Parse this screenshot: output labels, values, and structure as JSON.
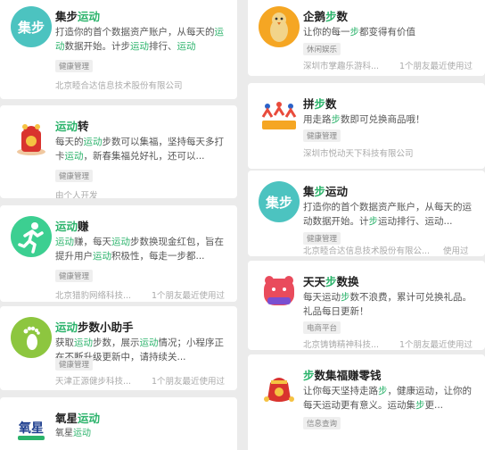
{
  "left": [
    {
      "icon": "jibu-logo-icon",
      "icon_text": "集步",
      "title": [
        {
          "t": "集步"
        },
        {
          "t": "运动",
          "g": true
        }
      ],
      "desc": [
        {
          "t": "打造你的首个数据资产账户，从每天的"
        },
        {
          "t": "运动",
          "g": true
        },
        {
          "t": "数据开始。计步"
        },
        {
          "t": "运动",
          "g": true
        },
        {
          "t": "排行、"
        },
        {
          "t": "运动",
          "g": true
        }
      ],
      "tag": "健康管理",
      "company": "北京睦合达信息技术股份有限公司",
      "friends": ""
    },
    {
      "icon": "red-envelope-fortune-icon",
      "title": [
        {
          "t": "运动",
          "g": true
        },
        {
          "t": "转"
        }
      ],
      "desc": [
        {
          "t": "每天的"
        },
        {
          "t": "运动",
          "g": true
        },
        {
          "t": "步数可以集福，坚持每天多打卡"
        },
        {
          "t": "运动",
          "g": true
        },
        {
          "t": "，新春集福兑好礼，还可以..."
        }
      ],
      "tag": "健康管理",
      "company": "由个人开发",
      "friends": ""
    },
    {
      "icon": "running-man-icon",
      "title": [
        {
          "t": "运动",
          "g": true
        },
        {
          "t": "赚"
        }
      ],
      "desc": [
        {
          "t": "运动",
          "g": true
        },
        {
          "t": "赚，每天"
        },
        {
          "t": "运动",
          "g": true
        },
        {
          "t": "步数换现金红包，旨在提升用户"
        },
        {
          "t": "运动",
          "g": true
        },
        {
          "t": "积极性，每走一步都..."
        }
      ],
      "tag": "健康管理",
      "company": "北京猎豹网络科技...",
      "friends": "1个朋友最近使用过"
    },
    {
      "icon": "footprint-icon",
      "title": [
        {
          "t": "运动",
          "g": true
        },
        {
          "t": "步数小助手"
        }
      ],
      "desc": [
        {
          "t": "获取"
        },
        {
          "t": "运动",
          "g": true
        },
        {
          "t": "步数，展示"
        },
        {
          "t": "运动",
          "g": true
        },
        {
          "t": "情况；小程序正在不断升级更新中，请持续关..."
        }
      ],
      "tag": "健康管理",
      "company": "天津正源健步科技...",
      "friends": "1个朋友最近使用过"
    },
    {
      "icon": "oxygen-star-logo-icon",
      "icon_text": "氧星",
      "title": [
        {
          "t": "氧星"
        },
        {
          "t": "运动",
          "g": true
        }
      ],
      "desc": [
        {
          "t": "氧星"
        },
        {
          "t": "运动",
          "g": true
        }
      ],
      "tag": "",
      "company": "",
      "friends": ""
    }
  ],
  "right": [
    {
      "icon": "penguin-icon",
      "title": [
        {
          "t": "企鹅"
        },
        {
          "t": "步",
          "g": true
        },
        {
          "t": "数"
        }
      ],
      "desc": [
        {
          "t": "让你的每一"
        },
        {
          "t": "步",
          "g": true
        },
        {
          "t": "都变得有价值"
        }
      ],
      "tag": "休闲娱乐",
      "company": "深圳市掌趣乐游科...",
      "friends": "1个朋友最近使用过"
    },
    {
      "icon": "pinbushu-logo-icon",
      "title": [
        {
          "t": "拼"
        },
        {
          "t": "步",
          "g": true
        },
        {
          "t": "数"
        }
      ],
      "desc": [
        {
          "t": "用走路"
        },
        {
          "t": "步",
          "g": true
        },
        {
          "t": "数即可兑换商品哦！"
        }
      ],
      "tag": "健康管理",
      "company": "深圳市悦动天下科技有限公司",
      "friends": ""
    },
    {
      "icon": "jibu-logo-icon",
      "icon_text": "集步",
      "title": [
        {
          "t": "集"
        },
        {
          "t": "步",
          "g": true
        },
        {
          "t": "运动"
        }
      ],
      "desc": [
        {
          "t": "打造你的首个数据资产账户，从每天的运动数据开始。计"
        },
        {
          "t": "步",
          "g": true
        },
        {
          "t": "运动排行、运动..."
        }
      ],
      "tag": "健康管理",
      "company": "北京睦合达信息技术股份有限公...",
      "friends": "使用过"
    },
    {
      "icon": "bear-step-exchange-icon",
      "title": [
        {
          "t": "天天"
        },
        {
          "t": "步",
          "g": true
        },
        {
          "t": "数换"
        }
      ],
      "desc": [
        {
          "t": "每天运动"
        },
        {
          "t": "步",
          "g": true
        },
        {
          "t": "数不浪费，累计可兑换礼品。礼品每日更新！"
        }
      ],
      "tag": "电商平台",
      "company": "北京铸铸精神科技...",
      "friends": "1个朋友最近使用过"
    },
    {
      "icon": "fortune-bag-icon",
      "title": [
        {
          "t": "步",
          "g": true
        },
        {
          "t": "数集福赚零钱"
        }
      ],
      "desc": [
        {
          "t": "让你每天坚持走路"
        },
        {
          "t": "步",
          "g": true
        },
        {
          "t": "，健康运动，让你的每天运动更有意义。运动集"
        },
        {
          "t": "步",
          "g": true
        },
        {
          "t": "更..."
        }
      ],
      "tag": "信息查询",
      "company": "",
      "friends": ""
    }
  ]
}
